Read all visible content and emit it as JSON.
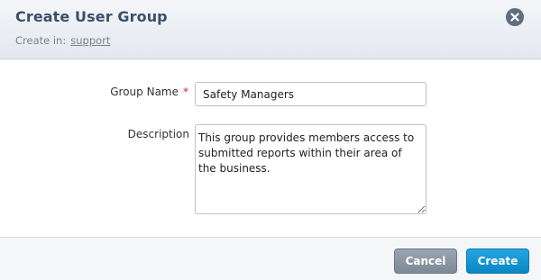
{
  "dialog": {
    "title": "Create User Group",
    "create_in_label": "Create in:",
    "create_in_link": "support",
    "close_icon": "close-icon"
  },
  "form": {
    "group_name": {
      "label": "Group Name",
      "required_marker": "*",
      "value": "Safety Managers"
    },
    "description": {
      "label": "Description",
      "value": "This group provides members access to submitted reports within their area of the business."
    }
  },
  "footer": {
    "cancel_label": "Cancel",
    "create_label": "Create"
  },
  "colors": {
    "title": "#3a5068",
    "required": "#d22b2b",
    "cancel_button": "#8794a0",
    "create_button": "#1a9ad6",
    "close_button": "#5e6e7e"
  }
}
